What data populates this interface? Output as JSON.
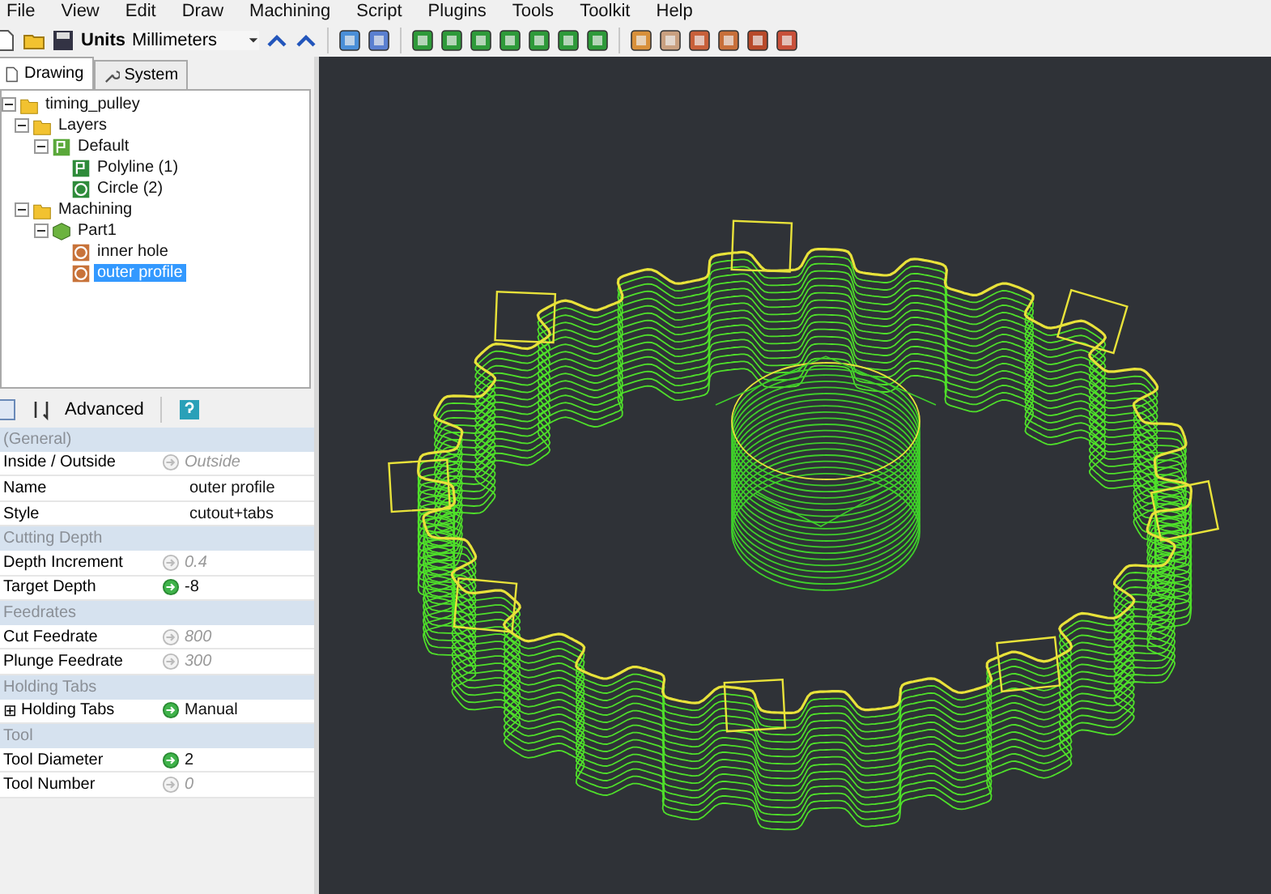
{
  "menu": [
    "File",
    "View",
    "Edit",
    "Draw",
    "Machining",
    "Script",
    "Plugins",
    "Tools",
    "Toolkit",
    "Help"
  ],
  "toolbar": {
    "units_label": "Units",
    "units_value": "Millimeters"
  },
  "tabs": [
    {
      "label": "Drawing",
      "selected": true
    },
    {
      "label": "System",
      "selected": false
    }
  ],
  "tree": [
    {
      "label": "timing_pulley",
      "kind": "folder",
      "selected": false,
      "children": [
        {
          "label": "Layers",
          "kind": "folder",
          "selected": false,
          "children": [
            {
              "label": "Default",
              "kind": "layer",
              "selected": false,
              "children": [
                {
                  "label": "Polyline (1)",
                  "kind": "polyline",
                  "selected": false
                },
                {
                  "label": "Circle (2)",
                  "kind": "circle",
                  "selected": false
                }
              ]
            }
          ]
        },
        {
          "label": "Machining",
          "kind": "folder",
          "selected": false,
          "children": [
            {
              "label": "Part1",
              "kind": "part",
              "selected": false,
              "children": [
                {
                  "label": "inner hole",
                  "kind": "operation",
                  "selected": false
                },
                {
                  "label": "outer profile",
                  "kind": "operation",
                  "selected": true
                }
              ]
            }
          ]
        }
      ]
    }
  ],
  "properties_toolbar": {
    "advanced": "Advanced"
  },
  "properties": [
    {
      "kind": "group",
      "name": "(General)"
    },
    {
      "kind": "property",
      "name": "Inside / Outside",
      "overridden": false,
      "value": "Outside"
    },
    {
      "kind": "property",
      "name": "Name",
      "value": "outer profile"
    },
    {
      "kind": "property",
      "name": "Style",
      "value": "cutout+tabs"
    },
    {
      "kind": "group",
      "name": "Cutting Depth"
    },
    {
      "kind": "property",
      "name": "Depth Increment",
      "overridden": false,
      "value": "0.4"
    },
    {
      "kind": "property",
      "name": "Target Depth",
      "overridden": true,
      "value": "-8"
    },
    {
      "kind": "group",
      "name": "Feedrates"
    },
    {
      "kind": "property",
      "name": "Cut Feedrate",
      "overridden": false,
      "value": "800"
    },
    {
      "kind": "property",
      "name": "Plunge Feedrate",
      "overridden": false,
      "value": "300"
    },
    {
      "kind": "group",
      "name": "Holding Tabs"
    },
    {
      "kind": "property",
      "name": "Holding Tabs",
      "overridden": true,
      "value": "Manual",
      "expander": "⊞"
    },
    {
      "kind": "group",
      "name": "Tool"
    },
    {
      "kind": "property",
      "name": "Tool Diameter",
      "overridden": true,
      "value": "2"
    },
    {
      "kind": "property",
      "name": "Tool Number",
      "overridden": false,
      "value": "0"
    }
  ]
}
